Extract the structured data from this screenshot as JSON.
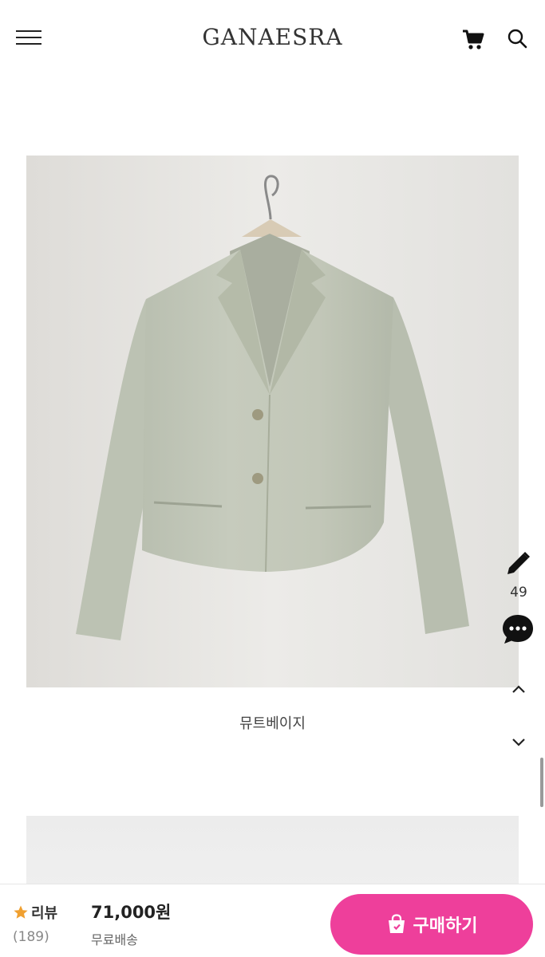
{
  "header": {
    "brand": "GANAESRA",
    "menu_icon": "hamburger-menu-icon",
    "cart_icon": "cart-icon",
    "search_icon": "search-icon"
  },
  "product": {
    "image_caption": "뮤트베이지",
    "jacket_color": "#c4c9bb"
  },
  "side_actions": {
    "review_write_icon": "pencil-icon",
    "review_count": "49",
    "chat_icon": "chat-bubble-icon",
    "scroll_up_icon": "chevron-up-icon",
    "scroll_down_icon": "chevron-down-icon"
  },
  "bottom_bar": {
    "review_label": "리뷰",
    "review_count": "(189)",
    "price": "71,000원",
    "shipping": "무료배송",
    "buy_label": "구매하기",
    "buy_color": "#ee3f9b",
    "star_color": "#f0a030"
  }
}
